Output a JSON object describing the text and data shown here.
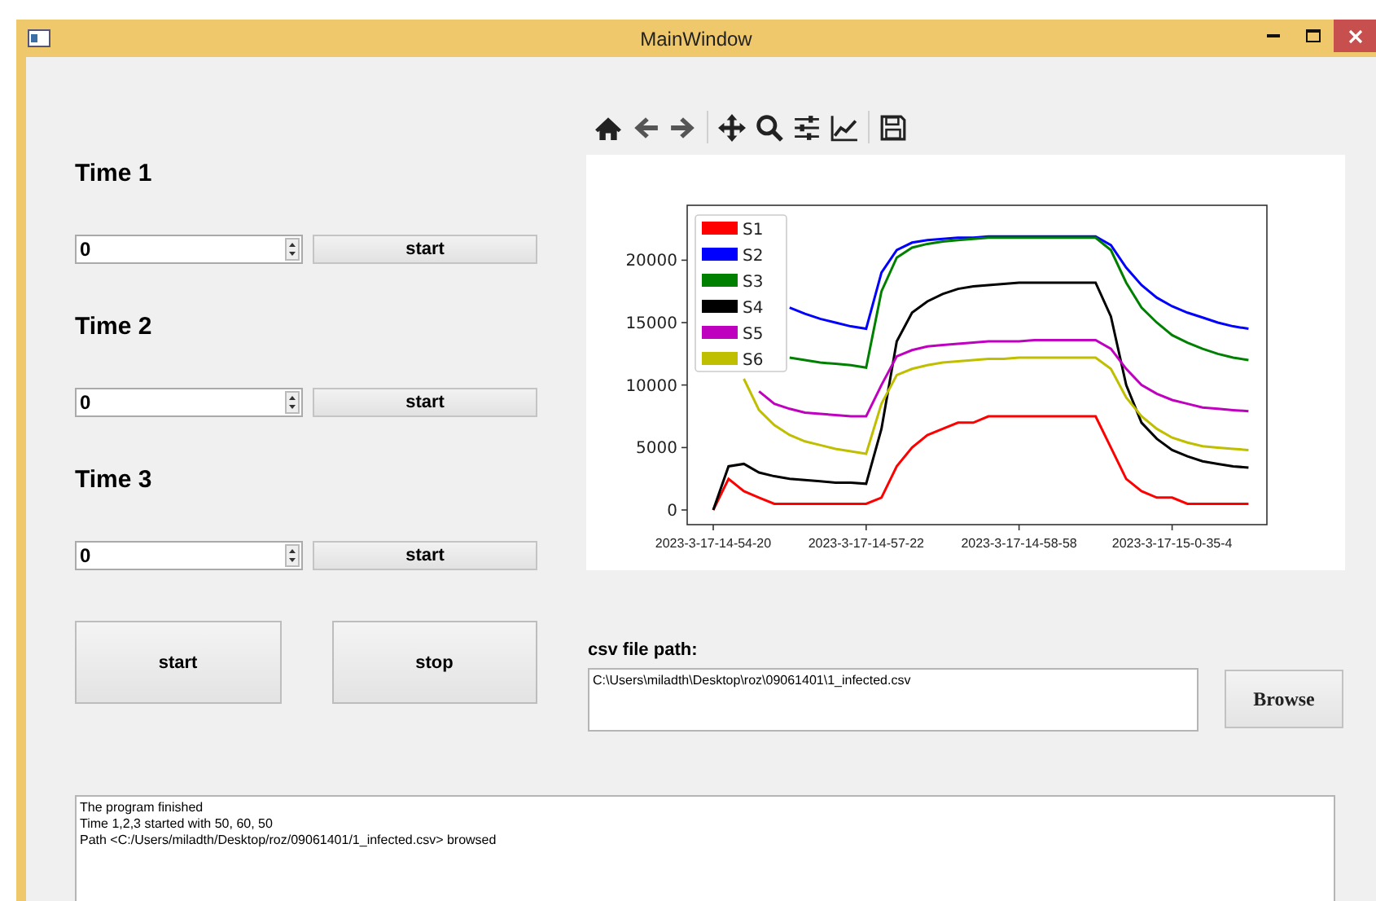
{
  "window": {
    "title": "MainWindow"
  },
  "timers": [
    {
      "label": "Time 1",
      "value": "0",
      "button": "start"
    },
    {
      "label": "Time 2",
      "value": "0",
      "button": "start"
    },
    {
      "label": "Time 3",
      "value": "0",
      "button": "start"
    }
  ],
  "action_buttons": [
    "start",
    "stop"
  ],
  "plot": {
    "chart_data": {
      "type": "line",
      "categories": [
        "2023-3-17-14-54-20",
        null,
        null,
        null,
        null,
        null,
        null,
        null,
        null,
        null,
        "2023-3-17-14-57-22",
        null,
        null,
        null,
        null,
        null,
        null,
        null,
        null,
        null,
        "2023-3-17-14-58-58",
        null,
        null,
        null,
        null,
        null,
        null,
        null,
        null,
        null,
        "2023-3-17-15-0-35-4",
        null,
        null,
        null,
        null,
        null
      ],
      "ylim": [
        -1170,
        24390
      ],
      "legend": "upper left",
      "yticks": [
        0,
        5000,
        10000,
        15000,
        20000
      ],
      "series": [
        {
          "name": "S1",
          "color": "#ff0000",
          "values": [
            0,
            2500,
            1500,
            1000,
            500,
            500,
            500,
            500,
            500,
            500,
            500,
            1000,
            3500,
            5000,
            6000,
            6500,
            7000,
            7000,
            7500,
            7500,
            7500,
            7500,
            7500,
            7500,
            7500,
            7500,
            5000,
            2500,
            1500,
            1000,
            1000,
            500,
            500,
            500,
            500,
            500
          ]
        },
        {
          "name": "S2",
          "color": "#0000ff",
          "values": [
            null,
            null,
            null,
            null,
            null,
            16200,
            15700,
            15300,
            15000,
            14700,
            14500,
            19000,
            20800,
            21400,
            21600,
            21700,
            21800,
            21800,
            21900,
            21900,
            21900,
            21900,
            21900,
            21900,
            21900,
            21900,
            21200,
            19400,
            18000,
            17000,
            16300,
            15800,
            15400,
            15000,
            14700,
            14500
          ]
        },
        {
          "name": "S3",
          "color": "#008000",
          "values": [
            null,
            null,
            null,
            null,
            null,
            12200,
            12000,
            11800,
            11700,
            11600,
            11400,
            17500,
            20200,
            21000,
            21300,
            21500,
            21600,
            21700,
            21800,
            21800,
            21800,
            21800,
            21800,
            21800,
            21800,
            21800,
            20800,
            18200,
            16200,
            15000,
            14000,
            13400,
            12900,
            12500,
            12200,
            12000
          ]
        },
        {
          "name": "S4",
          "color": "#000000",
          "values": [
            0,
            3500,
            3700,
            3000,
            2700,
            2500,
            2400,
            2300,
            2200,
            2200,
            2100,
            6500,
            13500,
            15800,
            16700,
            17300,
            17700,
            17900,
            18000,
            18100,
            18200,
            18200,
            18200,
            18200,
            18200,
            18200,
            15500,
            10000,
            7000,
            5700,
            4800,
            4300,
            3900,
            3700,
            3500,
            3400
          ]
        },
        {
          "name": "S5",
          "color": "#bf00bf",
          "values": [
            null,
            null,
            null,
            9500,
            8500,
            8100,
            7800,
            7700,
            7600,
            7500,
            7500,
            10000,
            12300,
            12800,
            13100,
            13200,
            13300,
            13400,
            13500,
            13500,
            13500,
            13600,
            13600,
            13600,
            13600,
            13600,
            12900,
            11300,
            10000,
            9300,
            8800,
            8500,
            8200,
            8100,
            8000,
            7900
          ]
        },
        {
          "name": "S6",
          "color": "#bfbf00",
          "values": [
            null,
            null,
            10500,
            8000,
            6800,
            6000,
            5500,
            5200,
            4900,
            4700,
            4500,
            8500,
            10800,
            11300,
            11600,
            11800,
            11900,
            12000,
            12100,
            12100,
            12200,
            12200,
            12200,
            12200,
            12200,
            12200,
            11300,
            9000,
            7500,
            6500,
            5800,
            5400,
            5100,
            5000,
            4900,
            4800
          ]
        }
      ]
    }
  },
  "csv": {
    "label": "csv file path:",
    "value": "C:\\Users\\miladth\\Desktop\\roz\\09061401\\1_infected.csv",
    "button": "Browse"
  },
  "log": [
    "The program finished",
    "Time 1,2,3 started with 50, 60, 50",
    "Path <C:/Users/miladth/Desktop/roz/09061401/1_infected.csv> browsed"
  ]
}
